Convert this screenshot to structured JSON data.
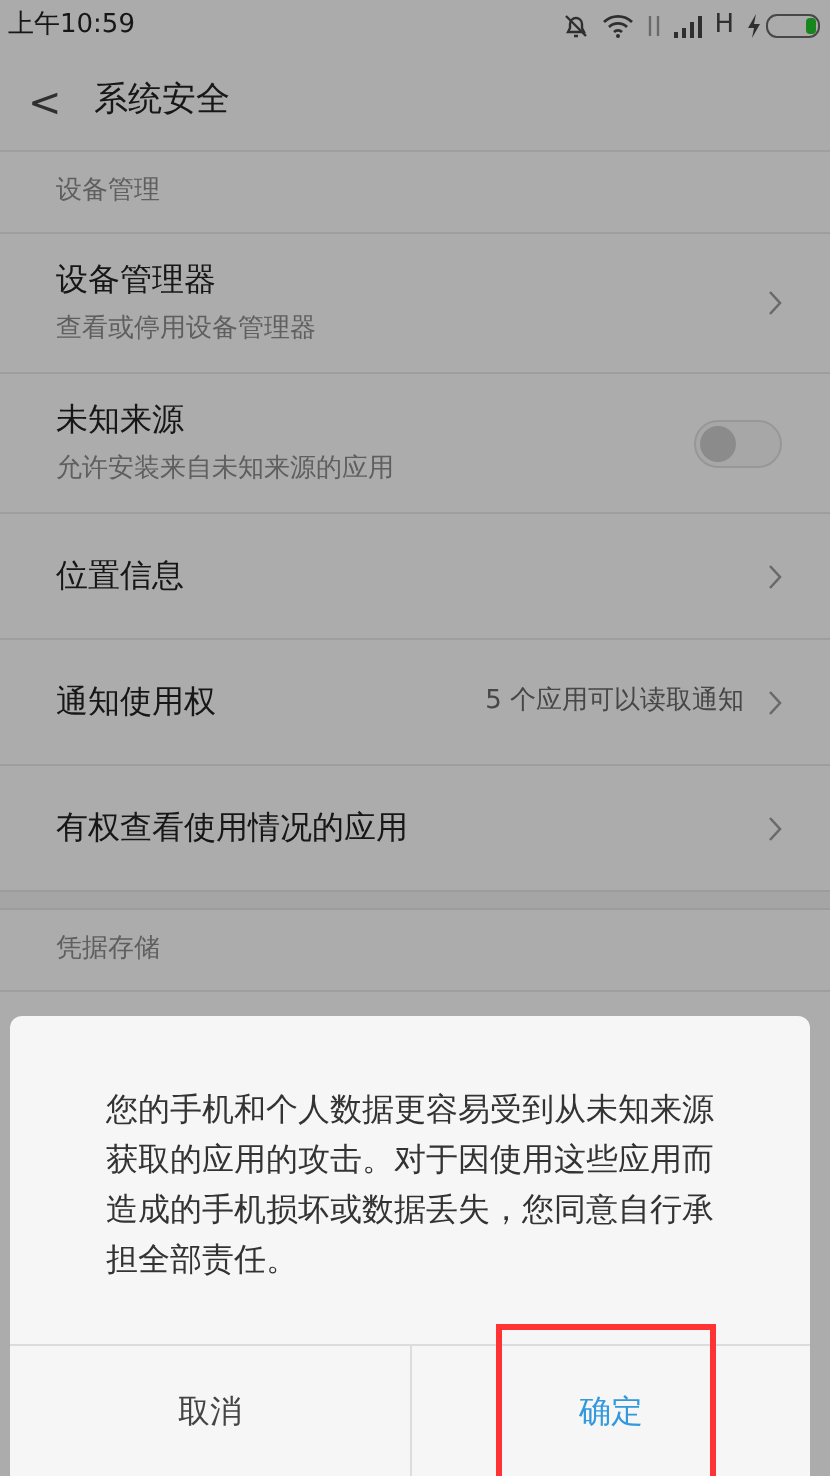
{
  "status_bar": {
    "time": "上午10:59",
    "network_type": "H"
  },
  "header": {
    "back": "<",
    "title": "系统安全"
  },
  "sections": [
    {
      "title": "设备管理",
      "items": [
        {
          "kind": "link",
          "title": "设备管理器",
          "subtitle": "查看或停用设备管理器"
        },
        {
          "kind": "toggle",
          "title": "未知来源",
          "subtitle": "允许安装来自未知来源的应用",
          "on": false
        },
        {
          "kind": "link",
          "title": "位置信息"
        },
        {
          "kind": "link",
          "title": "通知使用权",
          "value": "5 个应用可以读取通知"
        },
        {
          "kind": "link",
          "title": "有权查看使用情况的应用"
        }
      ]
    },
    {
      "title": "凭据存储"
    }
  ],
  "dialog": {
    "message": "您的手机和个人数据更容易受到从未知来源获取的应用的攻击。对于因使用这些应用而造成的手机损坏或数据丢失，您同意自行承担全部责任。",
    "buttons": [
      {
        "label": "取消",
        "kind": "cancel"
      },
      {
        "label": "确定",
        "kind": "confirm"
      }
    ]
  }
}
